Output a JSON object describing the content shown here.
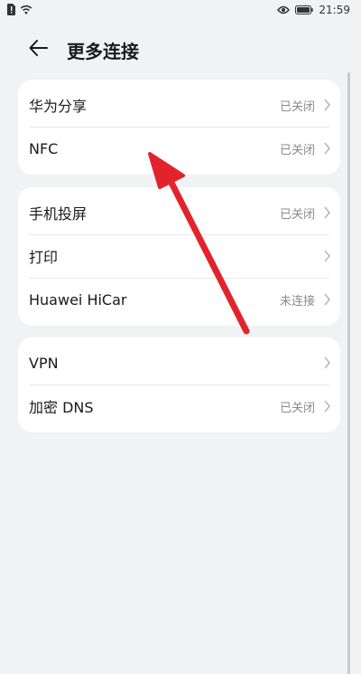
{
  "status_bar": {
    "time": "21:59",
    "left_icons": [
      "sim-alert-icon",
      "wifi-icon"
    ],
    "right_icons": [
      "eye-icon",
      "battery-icon"
    ]
  },
  "header": {
    "title": "更多连接",
    "back_icon": "arrow-left-icon"
  },
  "groups": [
    {
      "items": [
        {
          "label": "华为分享",
          "value": "已关闭"
        },
        {
          "label": "NFC",
          "value": "已关闭"
        }
      ]
    },
    {
      "items": [
        {
          "label": "手机投屏",
          "value": "已关闭"
        },
        {
          "label": "打印",
          "value": ""
        },
        {
          "label": "Huawei HiCar",
          "value": "未连接"
        }
      ]
    },
    {
      "items": [
        {
          "label": "VPN",
          "value": ""
        },
        {
          "label": "加密 DNS",
          "value": "已关闭"
        }
      ]
    }
  ],
  "colors": {
    "background": "#f1f2f4",
    "card": "#ffffff",
    "secondary_text": "#8a8a8e",
    "annotation_arrow": "#e3232c"
  }
}
